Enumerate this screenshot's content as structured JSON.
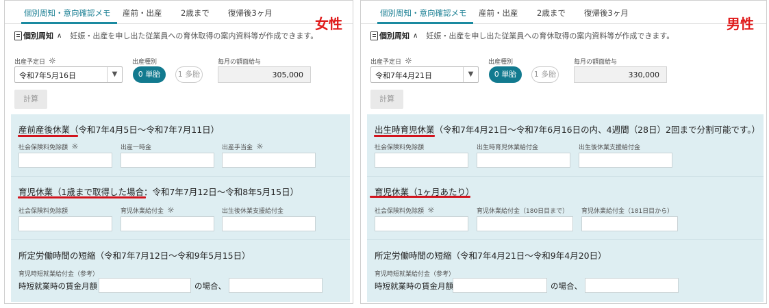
{
  "tabs": [
    "個別周知・意向確認メモ",
    "産前・出産",
    "2歳まで",
    "復帰後3ヶ月"
  ],
  "section": {
    "title": "個別周知",
    "desc": "妊娠・出産を申し出た従業員への育休取得の案内資料等が作成できます。"
  },
  "form_labels": {
    "due_date": "出産予定日",
    "birth_type": "出産種別",
    "monthly_salary": "毎月の額面給与"
  },
  "birth_options": [
    "0 単胎",
    "1 多胎"
  ],
  "calc_label": "計算",
  "left": {
    "gender": "女性",
    "due_date": "令和7年5月16日",
    "salary": "305,000",
    "sec1_title": "産前産後休業",
    "sec1_range": "（令和7年4月5日～令和7年7月11日）",
    "sec1_labels": [
      "社会保険料免除額",
      "出産一時金",
      "出産手当金"
    ],
    "sec2_title": "育児休業（1歳まで取得した場合",
    "sec2_range": "：令和7年7月12日～令和8年5月15日）",
    "sec2_labels": [
      "社会保険料免除額",
      "育児休業給付金",
      "出生後休業支援給付金"
    ],
    "sec3_title": "所定労働時間の短縮（令和7年7月12日～令和9年5月15日）",
    "sec3_sub": "育児時短就業給付金（参考）",
    "wage_label": "時短就業時の賃金月額",
    "case_label": "の場合、"
  },
  "right": {
    "gender": "男性",
    "due_date": "令和7年4月21日",
    "salary": "330,000",
    "sec1_title": "出生時育児休業",
    "sec1_range": "（令和7年4月21日～令和7年6月16日の内、4週間（28日）2回まで分割可能です。）",
    "sec1_labels": [
      "社会保険料免除額",
      "出生時育児休業給付金",
      "出生後休業支援給付金"
    ],
    "sec2_title": "育児休業（1ヶ月あたり）",
    "sec2_labels": [
      "社会保険料免除額",
      "育児休業給付金（180日目まで）",
      "育児休業給付金（181日目から）"
    ],
    "sec3_title": "所定労働時間の短縮（令和7年4月21日～令和9年4月20日）",
    "sec3_sub": "育児時短就業給付金（参考）",
    "wage_label": "時短就業時の賃金月額",
    "case_label": "の場合、"
  },
  "colors": {
    "accent": "#127a8f",
    "highlight_red": "#d2141d",
    "results_bg": "#deeef2"
  },
  "icons": {
    "info": "lightbulb-icon",
    "doc": "document-icon",
    "collapse": "chevron-up-icon",
    "dropdown": "triangle-down-icon"
  }
}
